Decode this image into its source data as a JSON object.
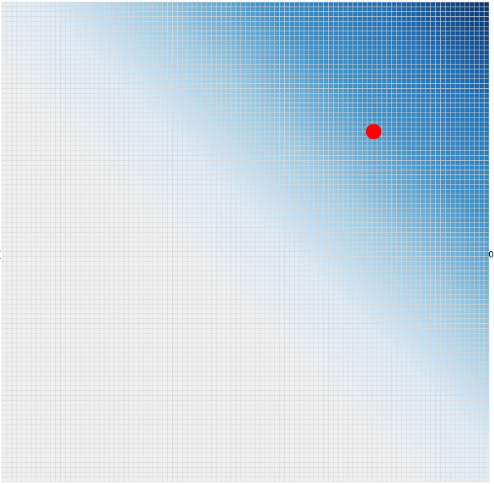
{
  "chart_data": {
    "type": "heatmap",
    "title": "",
    "xlabel": "",
    "ylabel": "",
    "grid": {
      "cols": 100,
      "rows": 100,
      "cell_stroke_color": "#d9d9d9"
    },
    "color_scale": {
      "low_color": "#efefef",
      "mid_color": "#9ecae1",
      "high_color": "#08306b",
      "threshold": 0.42,
      "description_low_to_high": [
        "#efefef",
        "#deebf7",
        "#9ecae1",
        "#4292c6",
        "#2171b5",
        "#08306b"
      ]
    },
    "left_edge_label": "(",
    "right_edge_label": "0",
    "marker": {
      "color": "#ff0000",
      "x_frac": 0.763,
      "y_frac": 0.27
    }
  }
}
